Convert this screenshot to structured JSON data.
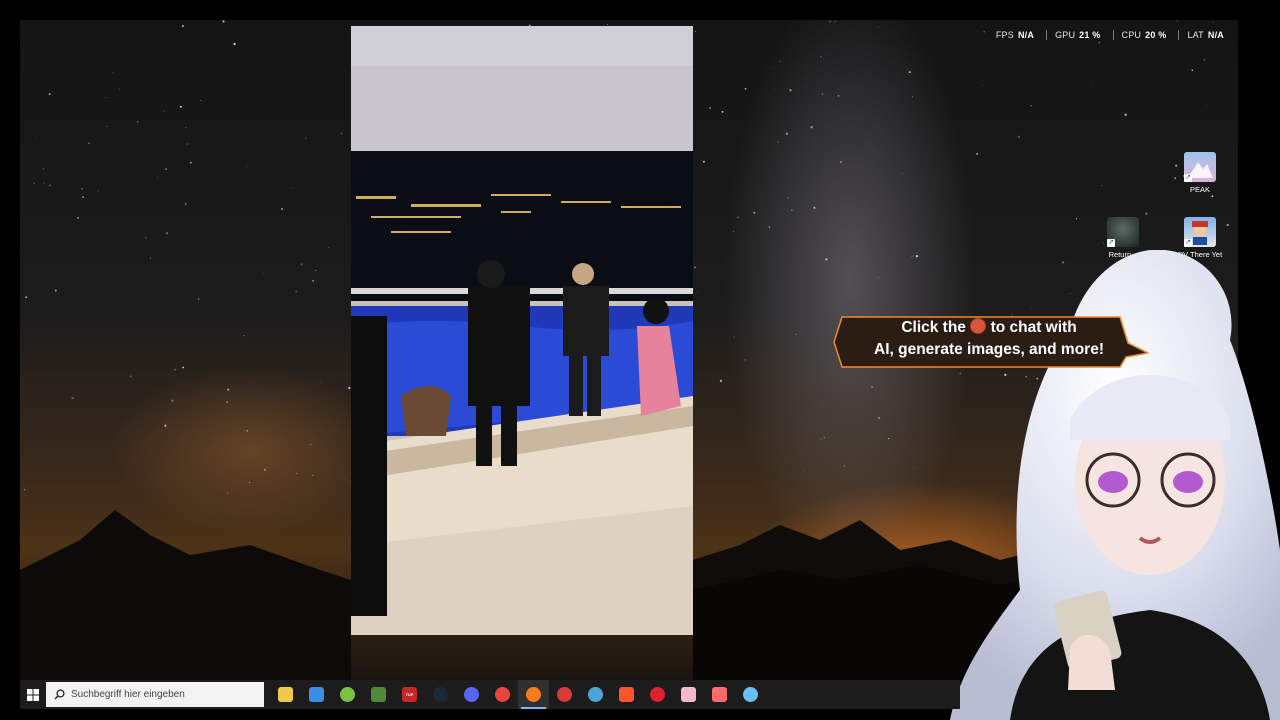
{
  "overlay": {
    "fps_label": "FPS",
    "fps_value": "N/A",
    "gpu_label": "GPU",
    "gpu_value": "21 %",
    "cpu_label": "CPU",
    "cpu_value": "20 %",
    "lat_label": "LAT",
    "lat_value": "N/A"
  },
  "desktop_icons": [
    {
      "label": "PEAK",
      "icon": "peak-game-icon"
    },
    {
      "label": "Return...",
      "icon": "return-game-icon"
    },
    {
      "label": "RV There Yet",
      "icon": "rv-there-yet-game-icon"
    }
  ],
  "assistant": {
    "bubble_line1_a": "Click the",
    "bubble_line1_b": "to chat with",
    "bubble_line2": "AI, generate images, and more!",
    "bubble_color": "#2b1d14",
    "bubble_border": "#f08a2a"
  },
  "taskbar": {
    "search_placeholder": "Suchbegriff hier eingeben",
    "apps": [
      {
        "name": "file-explorer-icon",
        "color": "#f2c84b"
      },
      {
        "name": "microsoft-store-icon",
        "color": "#3a8ee6"
      },
      {
        "name": "android-app-icon",
        "color": "#7cc242"
      },
      {
        "name": "minecraft-icon",
        "color": "#4f8a3a"
      },
      {
        "name": "sevenup-app-icon",
        "color": "#c62828",
        "label": "7UP"
      },
      {
        "name": "steam-icon",
        "color": "#1b2838"
      },
      {
        "name": "discord-icon",
        "color": "#5865f2"
      },
      {
        "name": "chrome-icon",
        "color": "#e8453c"
      },
      {
        "name": "firefox-icon",
        "color": "#ff7a1a"
      },
      {
        "name": "speed-test-icon",
        "color": "#d93a3a"
      },
      {
        "name": "loop-app-icon",
        "color": "#4aa6d8"
      },
      {
        "name": "brave-icon",
        "color": "#fb542b"
      },
      {
        "name": "opera-icon",
        "color": "#e0202e"
      },
      {
        "name": "pink-app-icon",
        "color": "#f4b9cc"
      },
      {
        "name": "tool-app-icon",
        "color": "#ff6b6b"
      },
      {
        "name": "steam-alt-icon",
        "color": "#66c0f4"
      }
    ]
  }
}
